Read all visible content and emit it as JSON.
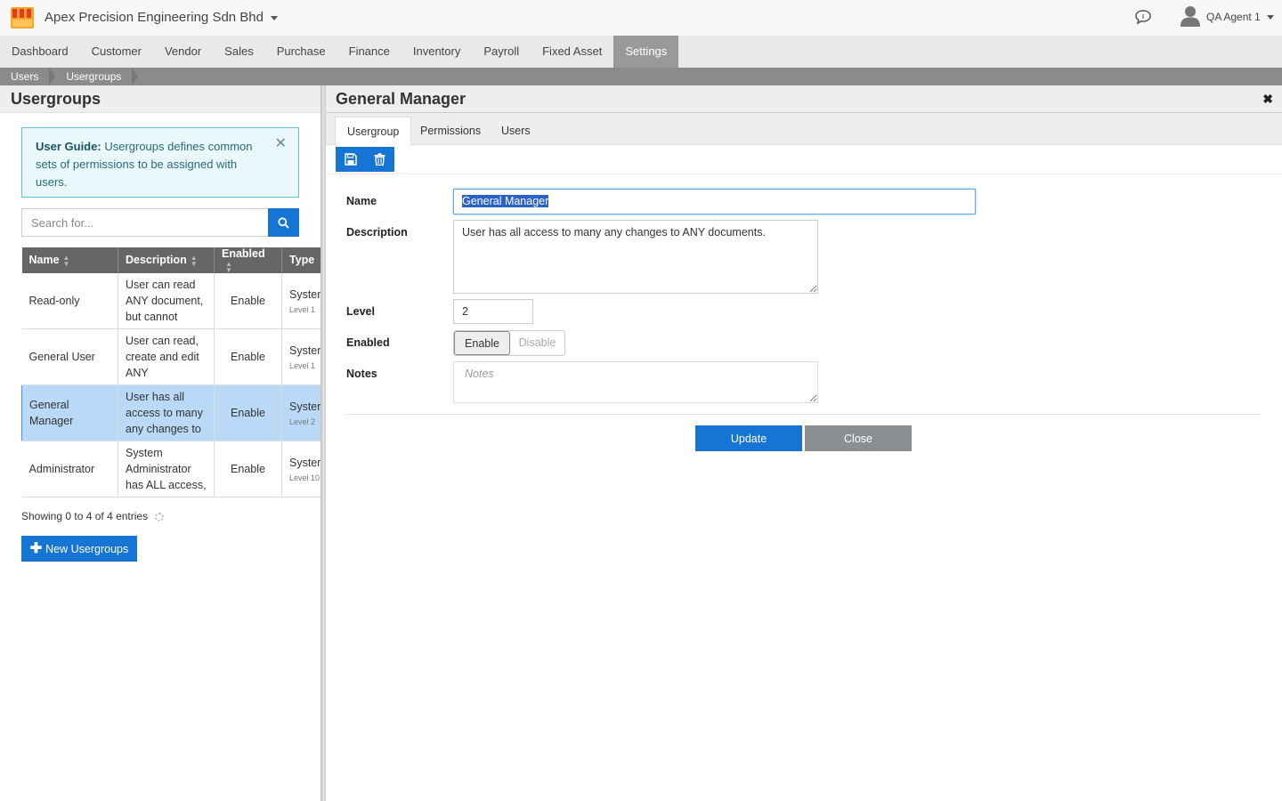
{
  "header": {
    "company": "Apex Precision Engineering Sdn Bhd",
    "user": "QA Agent 1",
    "brand_color": "#f5a623"
  },
  "nav": {
    "items": [
      "Dashboard",
      "Customer",
      "Vendor",
      "Sales",
      "Purchase",
      "Finance",
      "Inventory",
      "Payroll",
      "Fixed Asset",
      "Settings"
    ],
    "active": "Settings"
  },
  "breadcrumb": [
    "Users",
    "Usergroups"
  ],
  "left": {
    "title": "Usergroups",
    "guide_title": "User Guide:",
    "guide_text": "Usergroups defines common sets of permissions to be assigned with users.",
    "search_placeholder": "Search for...",
    "columns": [
      "Name",
      "Description",
      "Enabled",
      "Type"
    ],
    "rows": [
      {
        "name": "Read-only",
        "description": "User can read ANY document, but cannot make",
        "enabled": "Enable",
        "type": "System",
        "level": "Level 1"
      },
      {
        "name": "General User",
        "description": "User can read, create and edit ANY documents,",
        "enabled": "Enable",
        "type": "System",
        "level": "Level 1"
      },
      {
        "name": "General Manager",
        "description": "User has all access to many any changes to",
        "enabled": "Enable",
        "type": "System",
        "level": "Level 2",
        "selected": true
      },
      {
        "name": "Administrator",
        "description": "System Administrator has ALL access,",
        "enabled": "Enable",
        "type": "System",
        "level": "Level 10"
      }
    ],
    "showing": "Showing 0 to 4 of 4 entries",
    "new_button": "New Usergroups"
  },
  "right": {
    "title": "General Manager",
    "tabs": [
      "Usergroup",
      "Permissions",
      "Users"
    ],
    "active_tab": "Usergroup",
    "labels": {
      "name": "Name",
      "description": "Description",
      "level": "Level",
      "enabled": "Enabled",
      "notes": "Notes"
    },
    "values": {
      "name": "General Manager",
      "description": "User has all access to many any changes to ANY documents.",
      "level": "2",
      "notes_placeholder": "Notes"
    },
    "toggle": {
      "on": "Enable",
      "off": "Disable",
      "selected": "Enable"
    },
    "buttons": {
      "update": "Update",
      "close": "Close"
    }
  }
}
